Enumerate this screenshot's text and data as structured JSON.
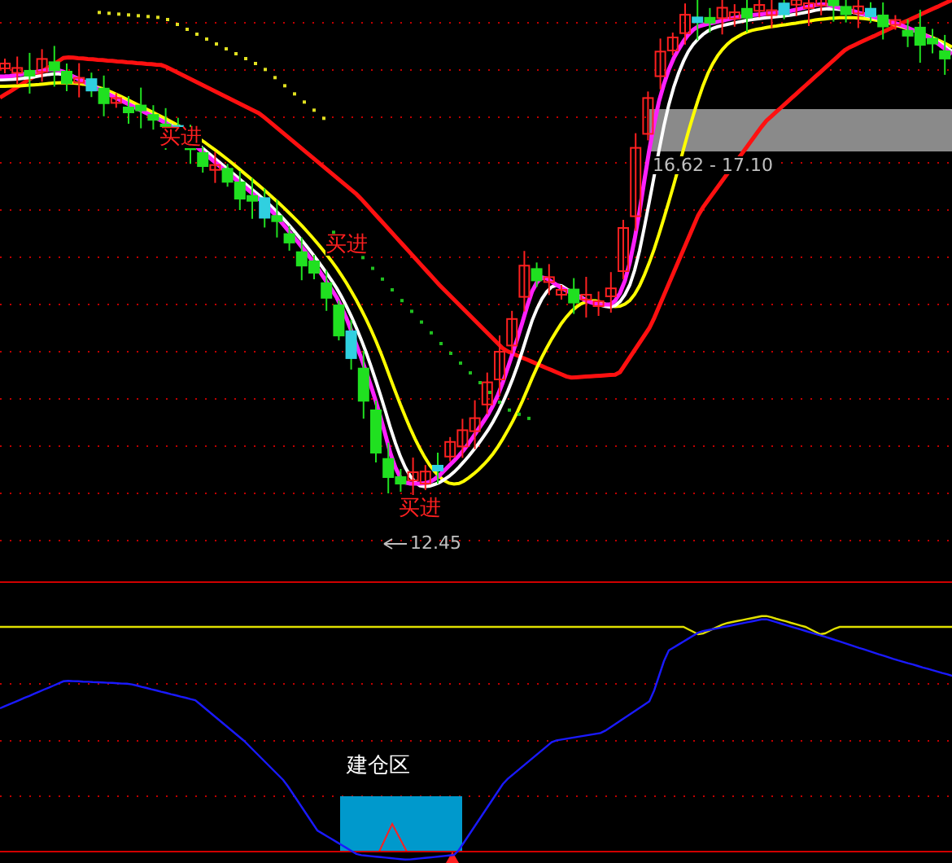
{
  "price_chart": {
    "buy_signals": [
      {
        "text": "买进"
      },
      {
        "text": "买进"
      },
      {
        "text": "买进"
      }
    ],
    "low_mark": "12.45",
    "range_label": "16.62 - 17.10"
  },
  "indicator": {
    "zone_label": "建仓区"
  }
}
